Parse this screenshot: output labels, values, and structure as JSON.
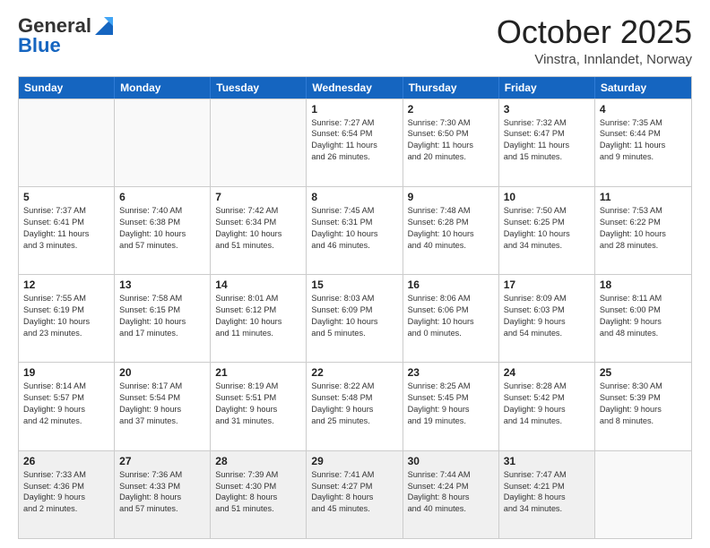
{
  "header": {
    "logo_line1": "General",
    "logo_line2": "Blue",
    "title": "October 2025",
    "subtitle": "Vinstra, Innlandet, Norway"
  },
  "days_of_week": [
    "Sunday",
    "Monday",
    "Tuesday",
    "Wednesday",
    "Thursday",
    "Friday",
    "Saturday"
  ],
  "weeks": [
    [
      {
        "day": "",
        "empty": true
      },
      {
        "day": "",
        "empty": true
      },
      {
        "day": "",
        "empty": true
      },
      {
        "day": "1",
        "lines": [
          "Sunrise: 7:27 AM",
          "Sunset: 6:54 PM",
          "Daylight: 11 hours",
          "and 26 minutes."
        ]
      },
      {
        "day": "2",
        "lines": [
          "Sunrise: 7:30 AM",
          "Sunset: 6:50 PM",
          "Daylight: 11 hours",
          "and 20 minutes."
        ]
      },
      {
        "day": "3",
        "lines": [
          "Sunrise: 7:32 AM",
          "Sunset: 6:47 PM",
          "Daylight: 11 hours",
          "and 15 minutes."
        ]
      },
      {
        "day": "4",
        "lines": [
          "Sunrise: 7:35 AM",
          "Sunset: 6:44 PM",
          "Daylight: 11 hours",
          "and 9 minutes."
        ]
      }
    ],
    [
      {
        "day": "5",
        "lines": [
          "Sunrise: 7:37 AM",
          "Sunset: 6:41 PM",
          "Daylight: 11 hours",
          "and 3 minutes."
        ]
      },
      {
        "day": "6",
        "lines": [
          "Sunrise: 7:40 AM",
          "Sunset: 6:38 PM",
          "Daylight: 10 hours",
          "and 57 minutes."
        ]
      },
      {
        "day": "7",
        "lines": [
          "Sunrise: 7:42 AM",
          "Sunset: 6:34 PM",
          "Daylight: 10 hours",
          "and 51 minutes."
        ]
      },
      {
        "day": "8",
        "lines": [
          "Sunrise: 7:45 AM",
          "Sunset: 6:31 PM",
          "Daylight: 10 hours",
          "and 46 minutes."
        ]
      },
      {
        "day": "9",
        "lines": [
          "Sunrise: 7:48 AM",
          "Sunset: 6:28 PM",
          "Daylight: 10 hours",
          "and 40 minutes."
        ]
      },
      {
        "day": "10",
        "lines": [
          "Sunrise: 7:50 AM",
          "Sunset: 6:25 PM",
          "Daylight: 10 hours",
          "and 34 minutes."
        ]
      },
      {
        "day": "11",
        "lines": [
          "Sunrise: 7:53 AM",
          "Sunset: 6:22 PM",
          "Daylight: 10 hours",
          "and 28 minutes."
        ]
      }
    ],
    [
      {
        "day": "12",
        "lines": [
          "Sunrise: 7:55 AM",
          "Sunset: 6:19 PM",
          "Daylight: 10 hours",
          "and 23 minutes."
        ]
      },
      {
        "day": "13",
        "lines": [
          "Sunrise: 7:58 AM",
          "Sunset: 6:15 PM",
          "Daylight: 10 hours",
          "and 17 minutes."
        ]
      },
      {
        "day": "14",
        "lines": [
          "Sunrise: 8:01 AM",
          "Sunset: 6:12 PM",
          "Daylight: 10 hours",
          "and 11 minutes."
        ]
      },
      {
        "day": "15",
        "lines": [
          "Sunrise: 8:03 AM",
          "Sunset: 6:09 PM",
          "Daylight: 10 hours",
          "and 5 minutes."
        ]
      },
      {
        "day": "16",
        "lines": [
          "Sunrise: 8:06 AM",
          "Sunset: 6:06 PM",
          "Daylight: 10 hours",
          "and 0 minutes."
        ]
      },
      {
        "day": "17",
        "lines": [
          "Sunrise: 8:09 AM",
          "Sunset: 6:03 PM",
          "Daylight: 9 hours",
          "and 54 minutes."
        ]
      },
      {
        "day": "18",
        "lines": [
          "Sunrise: 8:11 AM",
          "Sunset: 6:00 PM",
          "Daylight: 9 hours",
          "and 48 minutes."
        ]
      }
    ],
    [
      {
        "day": "19",
        "lines": [
          "Sunrise: 8:14 AM",
          "Sunset: 5:57 PM",
          "Daylight: 9 hours",
          "and 42 minutes."
        ]
      },
      {
        "day": "20",
        "lines": [
          "Sunrise: 8:17 AM",
          "Sunset: 5:54 PM",
          "Daylight: 9 hours",
          "and 37 minutes."
        ]
      },
      {
        "day": "21",
        "lines": [
          "Sunrise: 8:19 AM",
          "Sunset: 5:51 PM",
          "Daylight: 9 hours",
          "and 31 minutes."
        ]
      },
      {
        "day": "22",
        "lines": [
          "Sunrise: 8:22 AM",
          "Sunset: 5:48 PM",
          "Daylight: 9 hours",
          "and 25 minutes."
        ]
      },
      {
        "day": "23",
        "lines": [
          "Sunrise: 8:25 AM",
          "Sunset: 5:45 PM",
          "Daylight: 9 hours",
          "and 19 minutes."
        ]
      },
      {
        "day": "24",
        "lines": [
          "Sunrise: 8:28 AM",
          "Sunset: 5:42 PM",
          "Daylight: 9 hours",
          "and 14 minutes."
        ]
      },
      {
        "day": "25",
        "lines": [
          "Sunrise: 8:30 AM",
          "Sunset: 5:39 PM",
          "Daylight: 9 hours",
          "and 8 minutes."
        ]
      }
    ],
    [
      {
        "day": "26",
        "lines": [
          "Sunrise: 7:33 AM",
          "Sunset: 4:36 PM",
          "Daylight: 9 hours",
          "and 2 minutes."
        ]
      },
      {
        "day": "27",
        "lines": [
          "Sunrise: 7:36 AM",
          "Sunset: 4:33 PM",
          "Daylight: 8 hours",
          "and 57 minutes."
        ]
      },
      {
        "day": "28",
        "lines": [
          "Sunrise: 7:39 AM",
          "Sunset: 4:30 PM",
          "Daylight: 8 hours",
          "and 51 minutes."
        ]
      },
      {
        "day": "29",
        "lines": [
          "Sunrise: 7:41 AM",
          "Sunset: 4:27 PM",
          "Daylight: 8 hours",
          "and 45 minutes."
        ]
      },
      {
        "day": "30",
        "lines": [
          "Sunrise: 7:44 AM",
          "Sunset: 4:24 PM",
          "Daylight: 8 hours",
          "and 40 minutes."
        ]
      },
      {
        "day": "31",
        "lines": [
          "Sunrise: 7:47 AM",
          "Sunset: 4:21 PM",
          "Daylight: 8 hours",
          "and 34 minutes."
        ]
      },
      {
        "day": "",
        "empty": true
      }
    ]
  ]
}
